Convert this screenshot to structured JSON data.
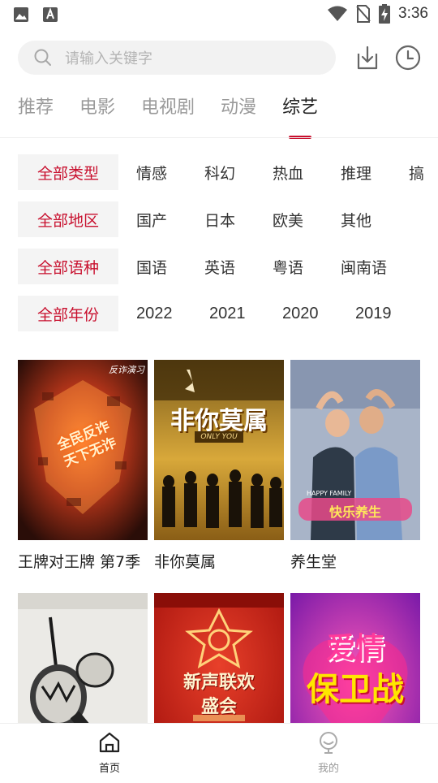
{
  "status_bar": {
    "time": "3:36"
  },
  "search": {
    "placeholder": "请输入关键字"
  },
  "tabs": [
    {
      "label": "推荐"
    },
    {
      "label": "电影"
    },
    {
      "label": "电视剧"
    },
    {
      "label": "动漫"
    },
    {
      "label": "综艺"
    }
  ],
  "active_tab": "综艺",
  "filters": {
    "type": {
      "label": "全部类型",
      "options": [
        "情感",
        "科幻",
        "热血",
        "推理",
        "搞"
      ]
    },
    "region": {
      "label": "全部地区",
      "options": [
        "国产",
        "日本",
        "欧美",
        "其他"
      ]
    },
    "language": {
      "label": "全部语种",
      "options": [
        "国语",
        "英语",
        "粤语",
        "闽南语"
      ]
    },
    "year": {
      "label": "全部年份",
      "options": [
        "2022",
        "2021",
        "2020",
        "2019"
      ]
    }
  },
  "shows": [
    {
      "title": "王牌对王牌 第7季",
      "poster_text": [
        "全民反诈",
        "天下无诈"
      ],
      "poster_corner_text": "反诈演习"
    },
    {
      "title": "非你莫属",
      "poster_text": [
        "非你莫属"
      ],
      "poster_sub": "ONLY YOU"
    },
    {
      "title": "养生堂",
      "poster_text": [
        "快乐养生"
      ],
      "poster_corner_text": "HAPPY FAMILY"
    },
    {
      "title": "",
      "poster_text": []
    },
    {
      "title": "",
      "poster_text": [
        "新声联欢",
        "盛会"
      ]
    },
    {
      "title": "",
      "poster_text": [
        "爱情",
        "保卫战"
      ]
    }
  ],
  "bottom_nav": [
    {
      "label": "首页",
      "icon": "home-icon"
    },
    {
      "label": "我的",
      "icon": "profile-icon"
    }
  ],
  "colors": {
    "accent": "#c8102e",
    "inactive": "#9a9a9a",
    "chip_bg": "#f4f4f4"
  }
}
